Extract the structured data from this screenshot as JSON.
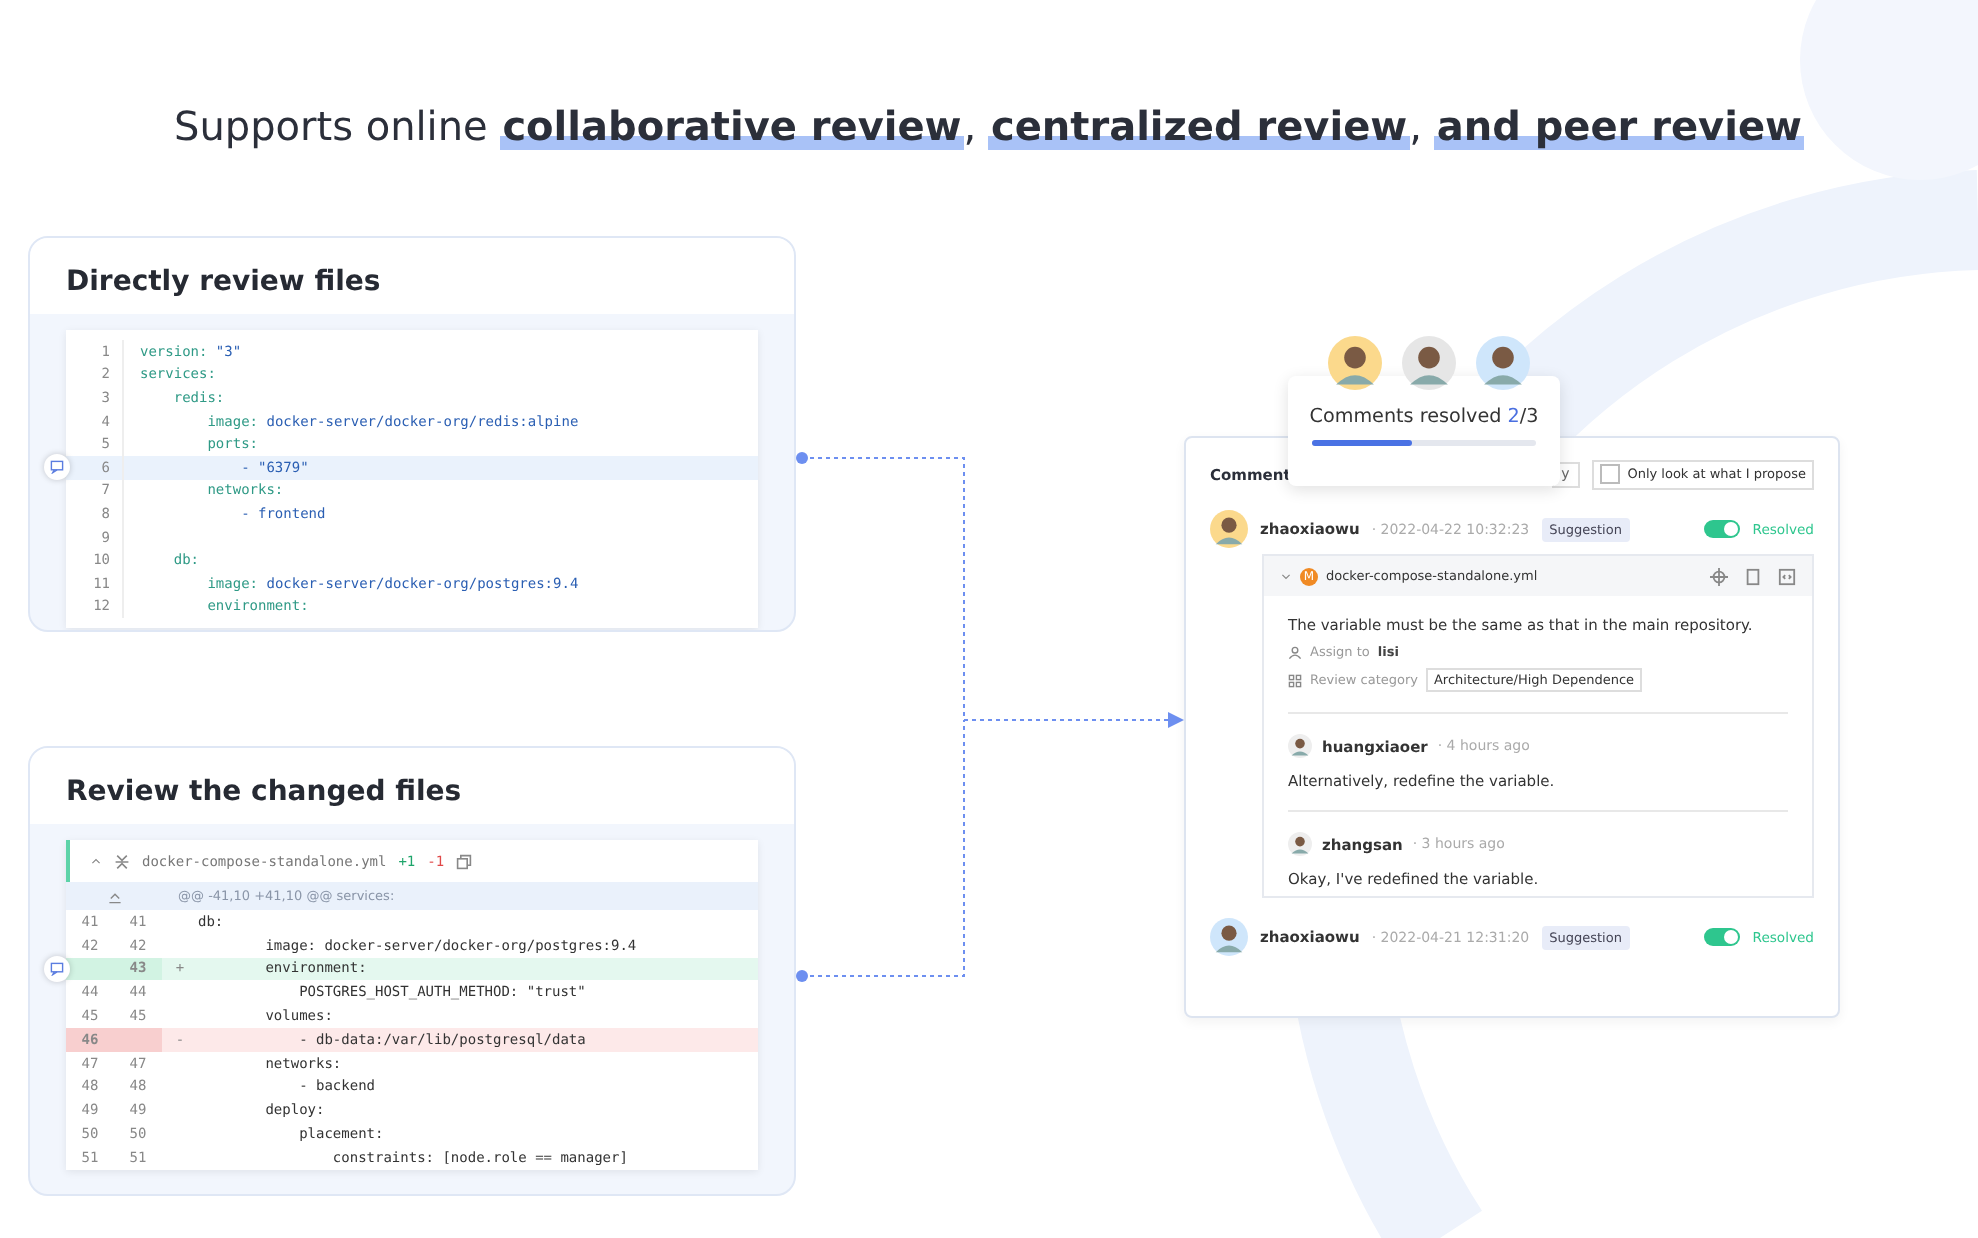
{
  "headline": "Supports online **collaborative review**, **centralized review**, **and peer review**",
  "file_card": {
    "title": "Directly review files",
    "lines": [
      {
        "num": "1",
        "key": "version:",
        "value": " \"3\"",
        "highlighted": false
      },
      {
        "num": "2",
        "key": "services:",
        "highlighted": false
      },
      {
        "num": "3",
        "key": "    redis:",
        "highlighted": false
      },
      {
        "num": "4",
        "key": "        image:",
        "value": " docker-server/docker-org/redis:alpine",
        "highlighted": false
      },
      {
        "num": "5",
        "key": "        ports:",
        "highlighted": false
      },
      {
        "num": "6",
        "value": "            - \"6379\"",
        "highlighted": true
      },
      {
        "num": "7",
        "key": "        networks:",
        "highlighted": false
      },
      {
        "num": "8",
        "value": "            - frontend",
        "highlighted": false
      },
      {
        "num": "9",
        "highlighted": false
      },
      {
        "num": "10",
        "key": "    db:",
        "highlighted": false
      },
      {
        "num": "11",
        "key": "        image:",
        "value": " docker-server/docker-org/postgres:9.4",
        "highlighted": false
      },
      {
        "num": "12",
        "key": "        environment:",
        "highlighted": false
      }
    ]
  },
  "diff_card": {
    "title": "Review the changed files",
    "file_name": "docker-compose-standalone.yml",
    "additions": "+1",
    "deletions": "-1",
    "hunk": "@@ -41,10 +41,10 @@ services:",
    "lines": [
      {
        "kind": "context",
        "old": "41",
        "new": "41",
        "text": "db:"
      },
      {
        "kind": "context",
        "old": "42",
        "new": "42",
        "text": "        image: docker-server/docker-org/postgres:9.4"
      },
      {
        "kind": "added",
        "new": "43",
        "sign": "+",
        "text": "        environment:"
      },
      {
        "kind": "context",
        "old": "44",
        "new": "44",
        "text": "            POSTGRES_HOST_AUTH_METHOD: \"trust\""
      },
      {
        "kind": "context",
        "old": "45",
        "new": "45",
        "text": "        volumes:"
      },
      {
        "kind": "removed",
        "old": "46",
        "sign": "-",
        "text": "            - db-data:/var/lib/postgresql/data"
      },
      {
        "kind": "context",
        "old": "47",
        "new": "47",
        "text": "        networks:"
      },
      {
        "kind": "context",
        "old": "48",
        "new": "48",
        "text": "            - backend"
      },
      {
        "kind": "context",
        "old": "49",
        "new": "49",
        "text": "        deploy:"
      },
      {
        "kind": "context",
        "old": "50",
        "new": "50",
        "text": "            placement:"
      },
      {
        "kind": "context",
        "old": "51",
        "new": "51",
        "text": "                constraints: [node.role == manager]"
      }
    ]
  },
  "popup": {
    "label": "Comments resolved",
    "count": "2",
    "total": "/3",
    "level": 0.45
  },
  "panel": {
    "title": "Comment",
    "button": "y",
    "filter": {
      "label": "Only look at what I propose",
      "checked": false
    },
    "comments": [
      {
        "author": "zhaoxiaowu",
        "time": "· 2022-04-22 10:32:23",
        "tag": "Suggestion",
        "resolved": {
          "on": true,
          "label": "Resolved"
        },
        "thread": {
          "file_badge": "M",
          "file_name": "docker-compose-standalone.yml",
          "text": "The variable must be the same as that in the main repository.",
          "assign_label": "Assign to",
          "assignee": "lisi",
          "category_label": "Review category",
          "category": "Architecture/High Dependence",
          "replies": [
            {
              "author": "huangxiaoer",
              "time": "· 4 hours ago",
              "text": "Alternatively, redefine the variable."
            },
            {
              "author": "zhangsan",
              "time": "· 3 hours ago",
              "text": "Okay, I've redefined the variable."
            }
          ]
        }
      },
      {
        "author": "zhaoxiaowu",
        "time": "· 2022-04-21 12:31:20",
        "tag": "Suggestion",
        "resolved": {
          "on": true,
          "label": "Resolved"
        }
      }
    ]
  }
}
